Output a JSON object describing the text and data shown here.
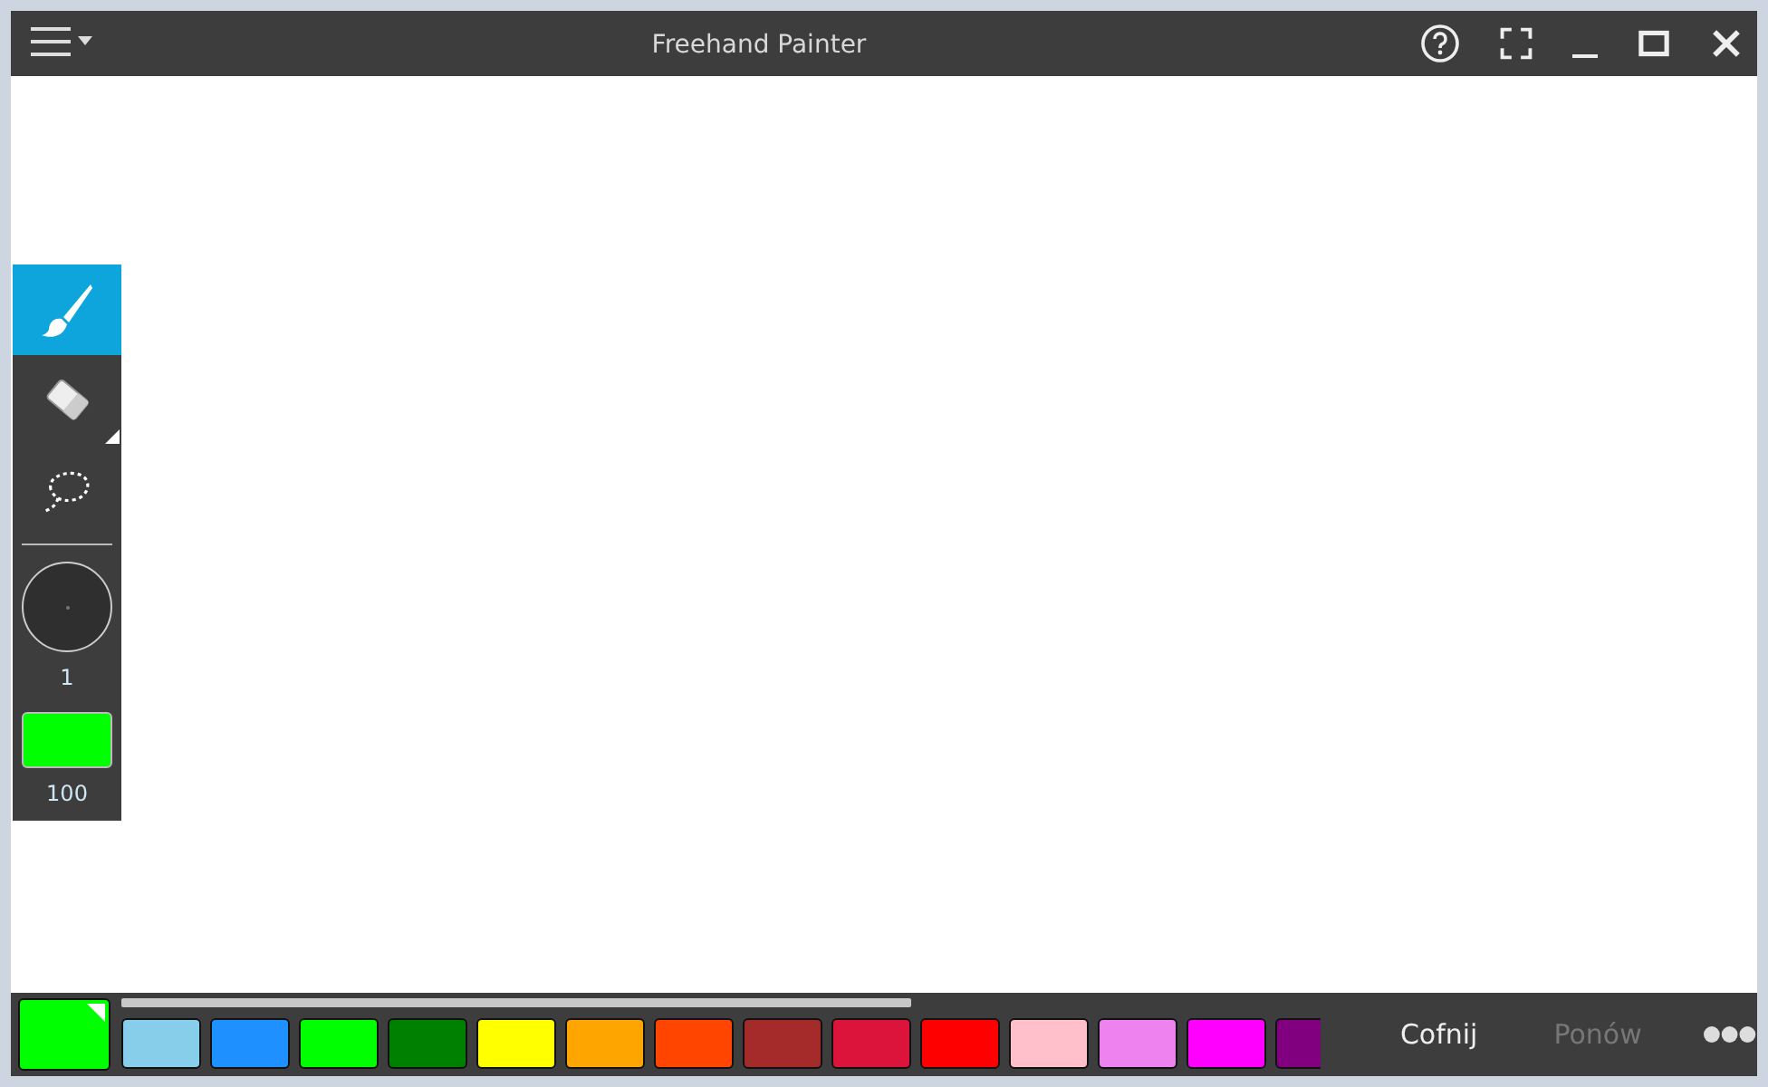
{
  "window": {
    "title": "Freehand Painter"
  },
  "tools": [
    {
      "kind": "brush",
      "selected": true,
      "submenu": false
    },
    {
      "kind": "eraser",
      "selected": false,
      "submenu": true
    },
    {
      "kind": "lasso",
      "selected": false,
      "submenu": false
    }
  ],
  "brush_size": {
    "reading": "1"
  },
  "opacity": {
    "color": "#00ff00",
    "reading": "100"
  },
  "current_color": {
    "color": "#00ff00"
  },
  "palette": [
    {
      "color": "#87ceeb"
    },
    {
      "color": "#1e90ff"
    },
    {
      "color": "#00ff00"
    },
    {
      "color": "#008000"
    },
    {
      "color": "#ffff00"
    },
    {
      "color": "#ffa500"
    },
    {
      "color": "#ff4500"
    },
    {
      "color": "#a52a2a"
    },
    {
      "color": "#dc143c"
    },
    {
      "color": "#ff0000"
    },
    {
      "color": "#ffc0cb"
    },
    {
      "color": "#ee82ee"
    },
    {
      "color": "#ff00ff"
    },
    {
      "color": "#800080"
    }
  ],
  "actions": [
    {
      "label": "Cofnij",
      "disabled": false
    },
    {
      "label": "Ponów",
      "disabled": true
    }
  ]
}
